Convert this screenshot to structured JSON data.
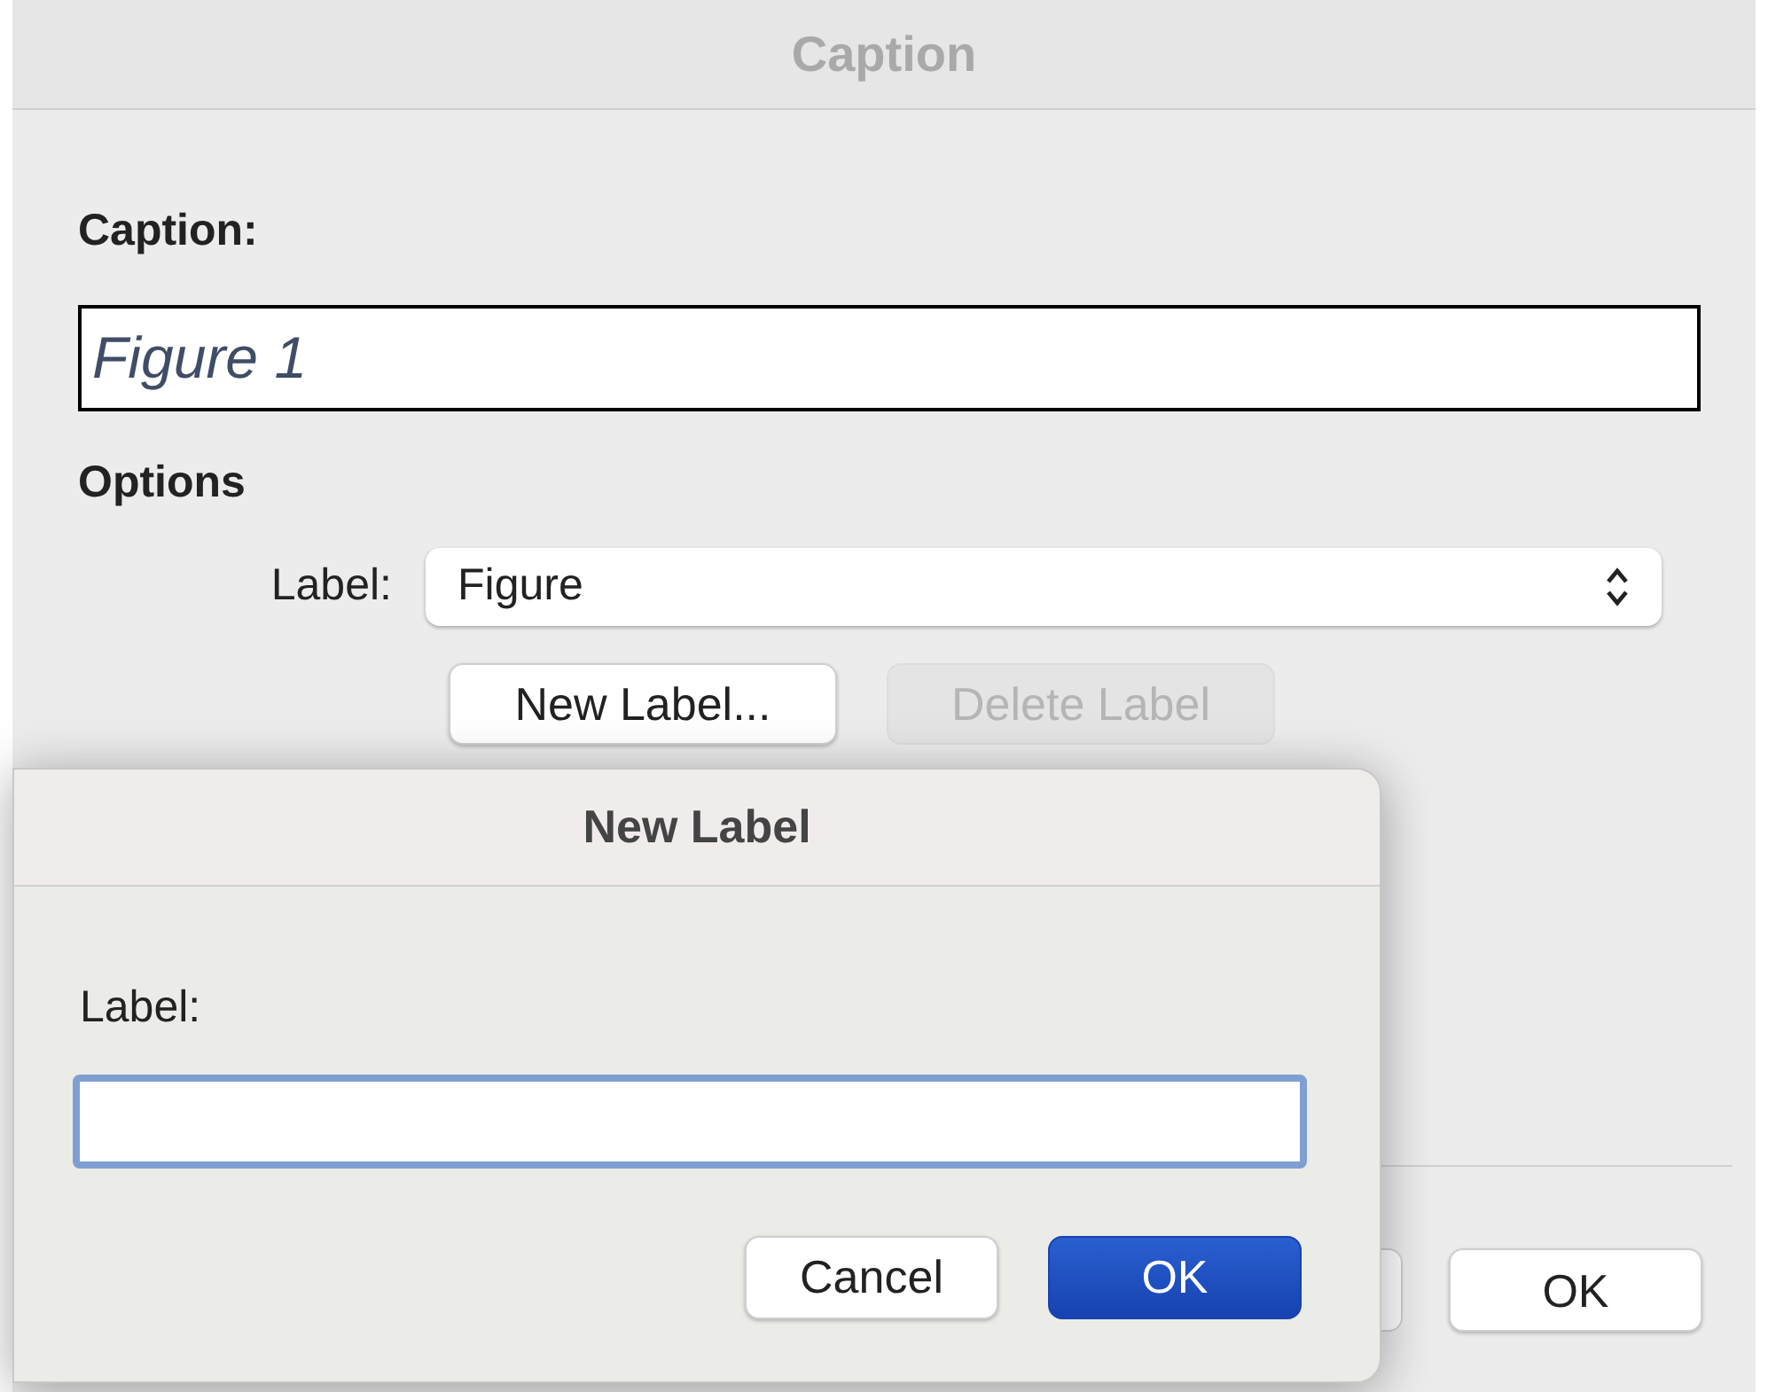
{
  "window": {
    "title": "Caption"
  },
  "caption": {
    "label": "Caption:",
    "value": "Figure 1"
  },
  "options": {
    "heading": "Options",
    "label": "Label:",
    "selected_value": "Figure",
    "buttons": [
      {
        "label": "New Label...",
        "disabled": false
      },
      {
        "label": "Delete Label",
        "disabled": true
      }
    ]
  },
  "footer_buttons": [
    {
      "label": "OK",
      "default": false
    }
  ],
  "sheet": {
    "title": "New Label",
    "field_label": "Label:",
    "focused": true,
    "buttons": [
      {
        "label": "Cancel",
        "default": false
      },
      {
        "label": "OK",
        "default": true
      }
    ]
  }
}
